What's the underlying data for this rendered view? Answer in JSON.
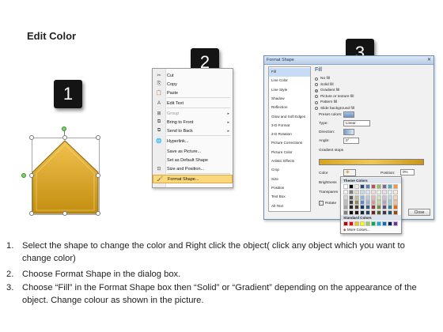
{
  "title": "Edit Color",
  "steps": [
    "1",
    "2",
    "3"
  ],
  "shape": {
    "fill_top": "#f2c24f",
    "fill_bottom": "#c28e10",
    "outline": "#8a6410"
  },
  "context_menu": {
    "items": [
      {
        "icon": "scissors-icon",
        "glyph": "✂",
        "label": "Cut",
        "disabled": false
      },
      {
        "icon": "copy-icon",
        "glyph": "⎘",
        "label": "Copy",
        "disabled": false
      },
      {
        "icon": "paste-icon",
        "glyph": "📋",
        "label": "Paste",
        "disabled": false
      },
      {
        "icon": "edit-text-icon",
        "glyph": "A",
        "label": "Edit Text",
        "disabled": false
      },
      {
        "icon": "group-icon",
        "glyph": "⊞",
        "label": "Group",
        "disabled": true,
        "submenu": true
      },
      {
        "icon": "bring-front-icon",
        "glyph": "⧉",
        "label": "Bring to Front",
        "disabled": false,
        "submenu": true
      },
      {
        "icon": "send-back-icon",
        "glyph": "⧉",
        "label": "Send to Back",
        "disabled": false,
        "submenu": true
      },
      {
        "icon": "hyperlink-icon",
        "glyph": "🌐",
        "label": "Hyperlink...",
        "disabled": false
      },
      {
        "icon": "",
        "glyph": "",
        "label": "Save as Picture...",
        "disabled": false
      },
      {
        "icon": "",
        "glyph": "",
        "label": "Set as Default Shape",
        "disabled": false
      },
      {
        "icon": "size-position-icon",
        "glyph": "⊡",
        "label": "Size and Position...",
        "disabled": false
      },
      {
        "icon": "format-shape-icon",
        "glyph": "🖌",
        "label": "Format Shape...",
        "disabled": false,
        "highlighted": true
      }
    ]
  },
  "dialog": {
    "title": "Format Shape",
    "categories": [
      "Fill",
      "Line Color",
      "Line Style",
      "Shadow",
      "Reflection",
      "Glow and Soft Edges",
      "3-D Format",
      "3-D Rotation",
      "Picture Corrections",
      "Picture Color",
      "Artistic Effects",
      "Crop",
      "Size",
      "Position",
      "Text Box",
      "Alt Text"
    ],
    "selected_category": "Fill",
    "pane_heading": "Fill",
    "fill_options": [
      "No fill",
      "Solid fill",
      "Gradient fill",
      "Picture or texture fill",
      "Pattern fill",
      "Slide background fill"
    ],
    "selected_fill": "Gradient fill",
    "preset_colors_label": "Preset colors:",
    "type_label": "Type:",
    "type_value": "Linear",
    "direction_label": "Direction:",
    "angle_label": "Angle:",
    "angle_value": "0°",
    "gradient_stops_label": "Gradient stops",
    "color_label": "Color",
    "position_label": "Position:",
    "position_value": "0%",
    "brightness_label": "Brightness",
    "transparency_label": "Transparen",
    "rotate_label": "Rotate",
    "close_label": "Close"
  },
  "color_popup": {
    "theme_label": "Theme Colors",
    "standard_label": "Standard Colors",
    "more_label": "More Colors...",
    "theme_rows": [
      [
        "#ffffff",
        "#000000",
        "#eeece1",
        "#1f497d",
        "#4f81bd",
        "#c0504d",
        "#9bbb59",
        "#8064a2",
        "#4bacc6",
        "#f79646"
      ],
      [
        "#f2f2f2",
        "#7f7f7f",
        "#ddd9c3",
        "#c6d9f0",
        "#dbe5f1",
        "#f2dcdb",
        "#ebf1dd",
        "#e5e0ec",
        "#dbeef3",
        "#fdeada"
      ],
      [
        "#d8d8d8",
        "#595959",
        "#c4bd97",
        "#8db3e2",
        "#b8cce4",
        "#e5b9b7",
        "#d7e3bc",
        "#ccc1d9",
        "#b7dde8",
        "#fbd5b5"
      ],
      [
        "#bfbfbf",
        "#3f3f3f",
        "#938953",
        "#548dd4",
        "#95b3d7",
        "#d99694",
        "#c3d69b",
        "#b2a2c7",
        "#92cddc",
        "#fac08f"
      ],
      [
        "#a5a5a5",
        "#262626",
        "#494429",
        "#17365d",
        "#366092",
        "#953734",
        "#76923c",
        "#5f497a",
        "#31859b",
        "#e36c09"
      ],
      [
        "#7f7f7f",
        "#0c0c0c",
        "#1d1b10",
        "#0f243e",
        "#244061",
        "#632423",
        "#4f6128",
        "#3f3151",
        "#205867",
        "#974806"
      ]
    ],
    "standard": [
      "#c00000",
      "#ff0000",
      "#ffc000",
      "#ffff00",
      "#92d050",
      "#00b050",
      "#00b0f0",
      "#0070c0",
      "#002060",
      "#7030a0"
    ]
  },
  "instructions": [
    {
      "num": "1.",
      "text": "Select the shape to change the color and Right click the object( click any object which you want to change color)"
    },
    {
      "num": "2.",
      "text": "Choose Format Shape in the dialog box."
    },
    {
      "num": "3.",
      "text": "Choose “Fill” in the Format Shape box then “Solid” or “Gradient” depending on the appearance of the object. Change colour as shown in the picture."
    }
  ]
}
